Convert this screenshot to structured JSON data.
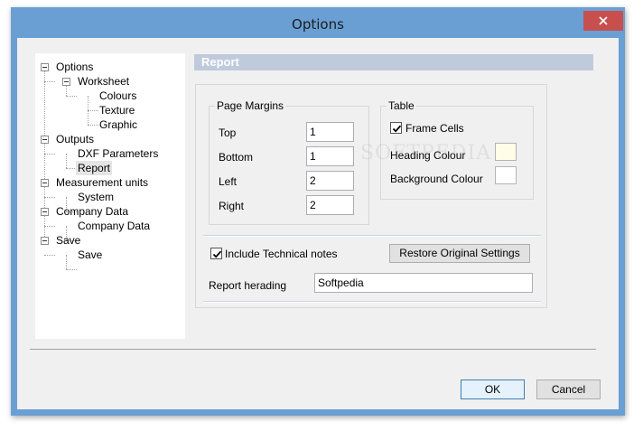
{
  "window": {
    "title": "Options"
  },
  "tree": {
    "options": "Options",
    "worksheet": "Worksheet",
    "colours": "Colours",
    "texture": "Texture",
    "graphic": "Graphic",
    "outputs": "Outputs",
    "dxf_parameters": "DXF Parameters",
    "report": "Report",
    "measurement_units": "Measurement units",
    "system": "System",
    "company_data_parent": "Company Data",
    "company_data": "Company Data",
    "save_parent": "Save",
    "save": "Save",
    "selected": "Report"
  },
  "panel": {
    "header": "Report",
    "page_margins": {
      "title": "Page Margins",
      "top_label": "Top",
      "top_value": "1",
      "bottom_label": "Bottom",
      "bottom_value": "1",
      "left_label": "Left",
      "left_value": "2",
      "right_label": "Right",
      "right_value": "2"
    },
    "table": {
      "title": "Table",
      "frame_cells_label": "Frame Cells",
      "frame_cells_checked": true,
      "heading_colour_label": "Heading Colour",
      "heading_colour": "#fffde8",
      "background_colour_label": "Background Colour",
      "background_colour": "#ffffff"
    },
    "include_notes_label": "Include Technical notes",
    "include_notes_checked": true,
    "restore_button": "Restore Original Settings",
    "report_heading_label": "Report herading",
    "report_heading_value": "Softpedia"
  },
  "buttons": {
    "ok": "OK",
    "cancel": "Cancel"
  },
  "watermark": "SOFTPEDIA",
  "colors": {
    "titlebar": "#6a9fd4",
    "close": "#c7504f",
    "accent": "#3c7fb1"
  }
}
